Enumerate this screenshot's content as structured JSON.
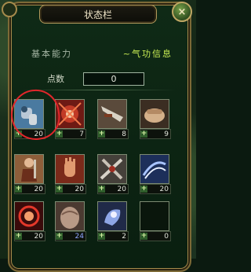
{
  "window": {
    "title": "状态栏",
    "close_label": "×"
  },
  "tabs": [
    {
      "label": "基本能力",
      "active": false
    },
    {
      "label": "~气功信息",
      "active": true
    }
  ],
  "points": {
    "label": "点数",
    "value": "0"
  },
  "skills": [
    {
      "name": "skill-1",
      "level": "20",
      "icon": "fist-glove-icon",
      "highlighted": true
    },
    {
      "name": "skill-2",
      "level": "7",
      "icon": "red-burst-icon"
    },
    {
      "name": "skill-3",
      "level": "8",
      "icon": "blade-icon"
    },
    {
      "name": "skill-4",
      "level": "9",
      "icon": "fist-icon"
    },
    {
      "name": "skill-5",
      "level": "20",
      "icon": "warrior-icon"
    },
    {
      "name": "skill-6",
      "level": "20",
      "icon": "palm-icon"
    },
    {
      "name": "skill-7",
      "level": "20",
      "icon": "crossed-swords-icon"
    },
    {
      "name": "skill-8",
      "level": "20",
      "icon": "blue-swirl-icon"
    },
    {
      "name": "skill-9",
      "level": "20",
      "icon": "red-vortex-icon"
    },
    {
      "name": "skill-10",
      "level": "24",
      "icon": "muscle-icon",
      "blue_level": true
    },
    {
      "name": "skill-11",
      "level": "2",
      "icon": "blue-hand-icon"
    },
    {
      "name": "skill-12",
      "level": "0",
      "icon": "empty-slot-icon"
    }
  ],
  "colors": {
    "active_tab": "#c9ee54",
    "frame_gold": "#a58a4c",
    "annotation_red": "#e2262b"
  }
}
